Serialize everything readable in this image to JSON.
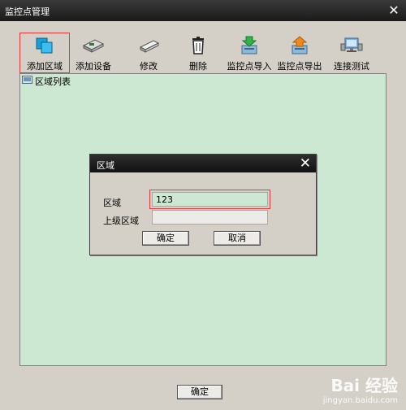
{
  "window": {
    "title": "监控点管理",
    "close_glyph": "✕"
  },
  "toolbar": {
    "items": [
      {
        "label": "添加区域",
        "icon": "add-area-icon",
        "selected": true
      },
      {
        "label": "添加设备",
        "icon": "add-device-icon"
      },
      {
        "label": "修改",
        "icon": "modify-icon"
      },
      {
        "label": "删除",
        "icon": "trash-icon"
      },
      {
        "label": "监控点导入",
        "icon": "import-icon"
      },
      {
        "label": "监控点导出",
        "icon": "export-icon"
      },
      {
        "label": "连接测试",
        "icon": "connection-test-icon"
      }
    ]
  },
  "list": {
    "header": "区域列表"
  },
  "dialog": {
    "title": "区域",
    "close_glyph": "✕",
    "area_label": "区域",
    "area_value": "123",
    "parent_label": "上级区域",
    "parent_value": "",
    "ok_label": "确定",
    "cancel_label": "取消"
  },
  "footer": {
    "ok_label": "确定"
  },
  "watermark": {
    "brand": "Bai 经验",
    "url": "jingyan.baidu.com"
  },
  "colors": {
    "list_bg": "#cde8d2",
    "highlight": "#e23a3a",
    "titlebar": "#1a1a1a"
  }
}
